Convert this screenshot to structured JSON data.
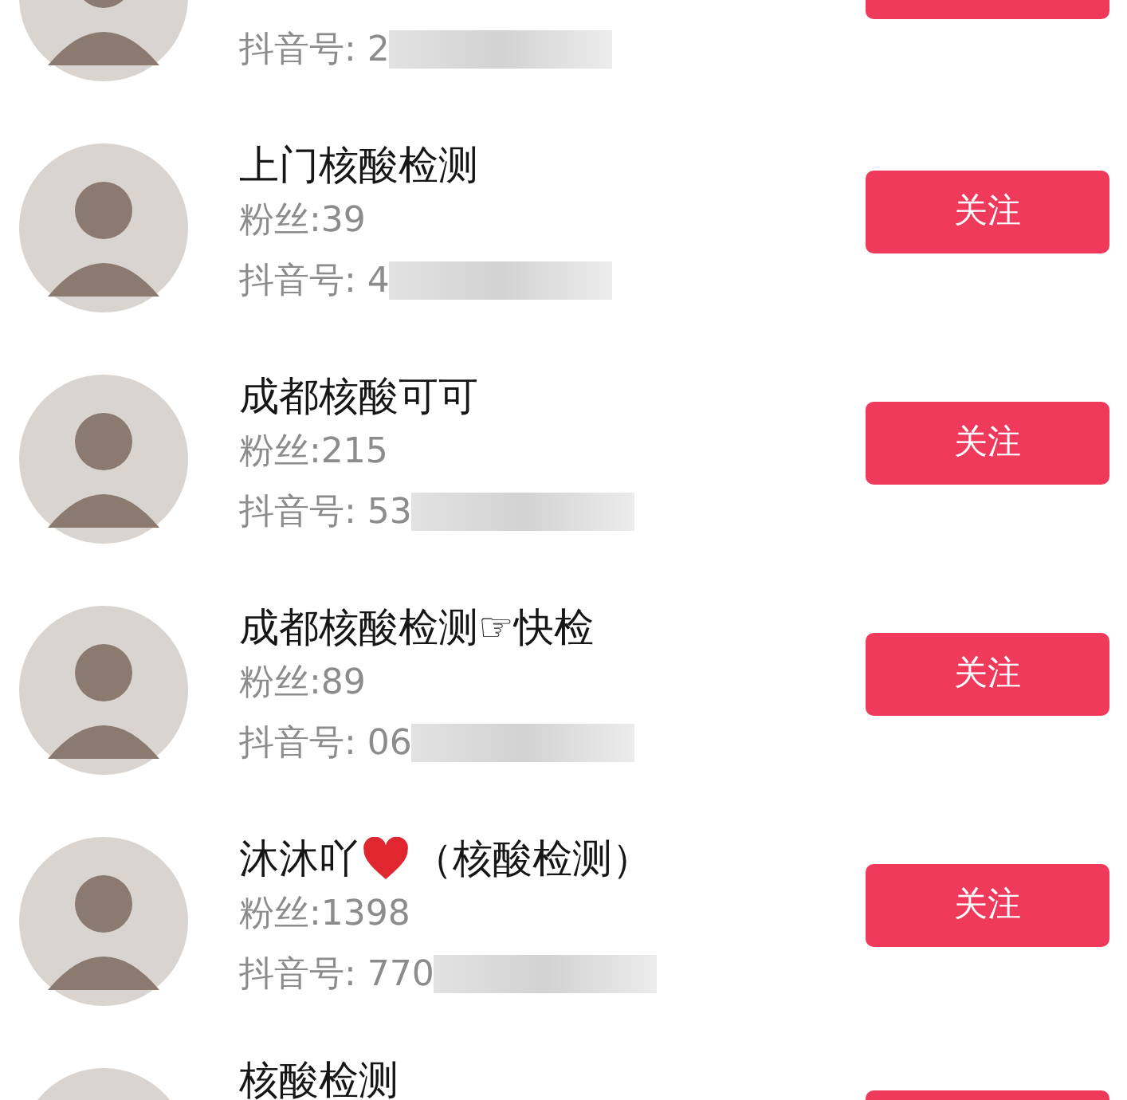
{
  "accounts": [
    {
      "douyin_id": "抖音号: 2"
    },
    {
      "name": [
        {
          "kind": "text",
          "text": "上门核酸检测"
        }
      ],
      "fans": "粉丝:39",
      "douyin_id": "抖音号: 4",
      "button": "关注"
    },
    {
      "name": [
        {
          "kind": "text",
          "text": "成都核酸可可"
        }
      ],
      "fans": "粉丝:215",
      "douyin_id": "抖音号: 53",
      "button": "关注"
    },
    {
      "name": [
        {
          "kind": "text",
          "text": "成都核酸检测☞快检"
        }
      ],
      "fans": "粉丝:89",
      "douyin_id": "抖音号: 06",
      "button": "关注"
    },
    {
      "name": [
        {
          "kind": "text",
          "text": "沐沐吖"
        },
        {
          "kind": "heart"
        },
        {
          "kind": "text",
          "text": "（核酸检测）"
        }
      ],
      "fans": "粉丝:1398",
      "douyin_id": "抖音号: 770",
      "button": "关注"
    },
    {
      "name": [
        {
          "kind": "text",
          "text": "核酸检测"
        }
      ]
    }
  ]
}
